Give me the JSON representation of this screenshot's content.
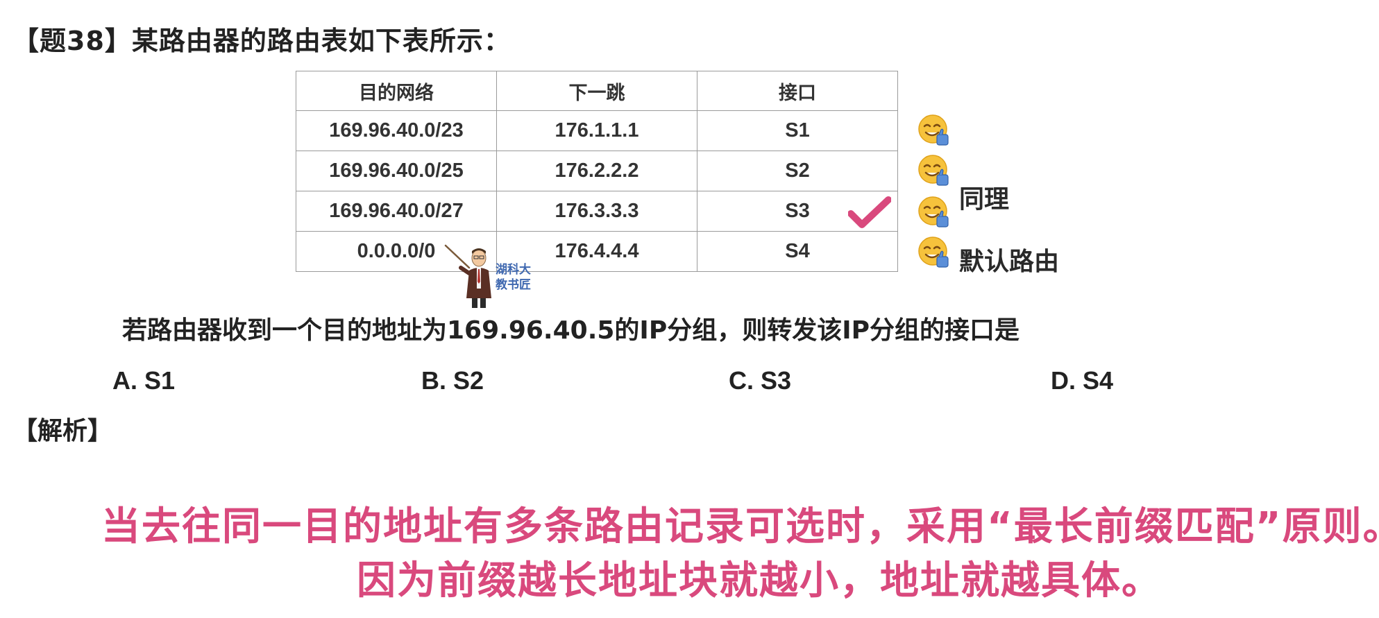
{
  "question": {
    "title": "【题38】某路由器的路由表如下表所示：",
    "stem": "若路由器收到一个目的地址为169.96.40.5的IP分组，则转发该IP分组的接口是",
    "options": [
      "A. S1",
      "B. S2",
      "C. S3",
      "D. S4"
    ]
  },
  "routing_table": {
    "headers": [
      "目的网络",
      "下一跳",
      "接口"
    ],
    "rows": [
      [
        "169.96.40.0/23",
        "176.1.1.1",
        "S1"
      ],
      [
        "169.96.40.0/25",
        "176.2.2.2",
        "S2"
      ],
      [
        "169.96.40.0/27",
        "176.3.3.3",
        "S3"
      ],
      [
        "0.0.0.0/0",
        "176.4.4.4",
        "S4"
      ]
    ],
    "selected_row": 2
  },
  "annotations": {
    "note_same": "同理",
    "note_default": "默认路由",
    "check_color": "#d9497d",
    "emoji_icon": "thumbs-up-face-icon"
  },
  "analysis": {
    "label": "【解析】",
    "line1": "当去往同一目的地址有多条路由记录可选时，采用“最长前缀匹配”原则。",
    "line2": "因为前缀越长地址块就越小，地址就越具体。"
  },
  "watermark": {
    "line1": "湖科大",
    "line2": "教书匠"
  }
}
